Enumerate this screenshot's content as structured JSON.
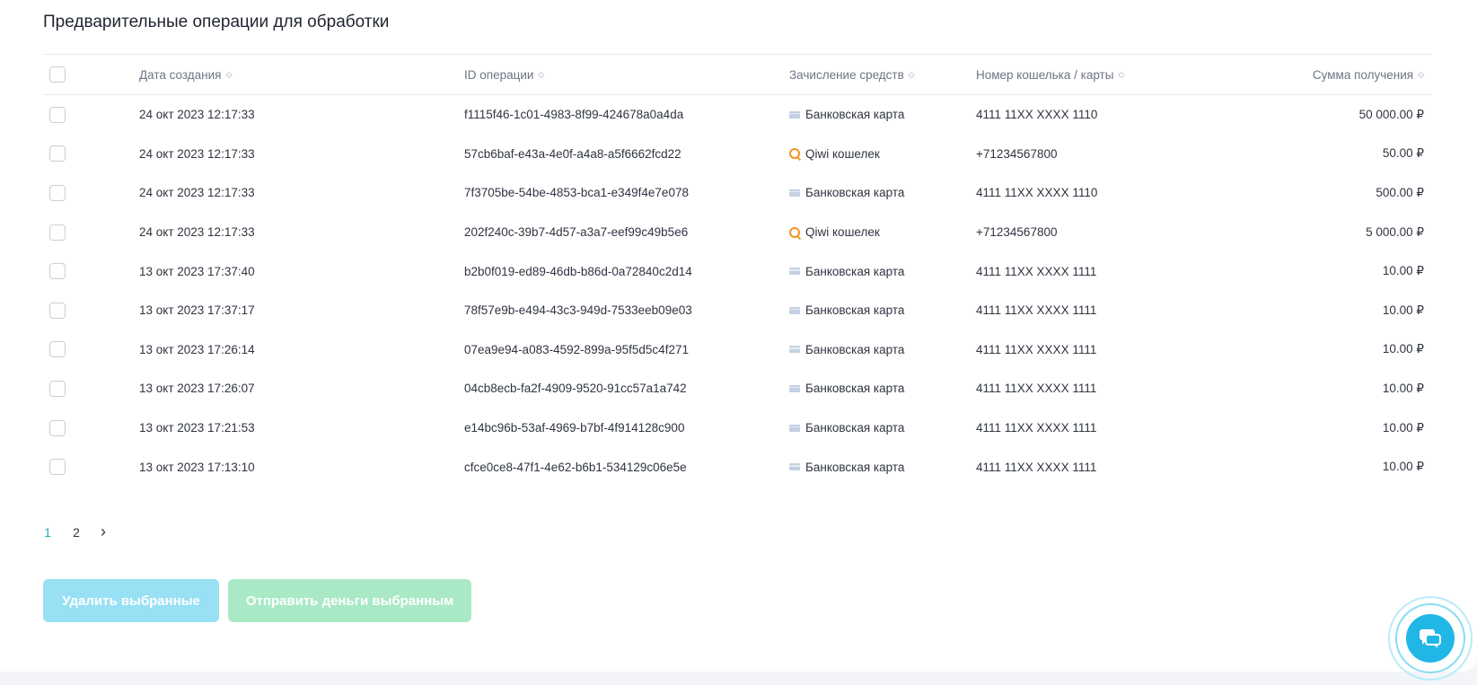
{
  "page": {
    "title": "Предварительные операции для обработки"
  },
  "table": {
    "columns": {
      "date": "Дата создания",
      "id": "ID операции",
      "method": "Зачисление средств",
      "wallet": "Номер кошелька / карты",
      "amount": "Сумма получения"
    },
    "rows": [
      {
        "date": "24 окт 2023 12:17:33",
        "id": "f1115f46-1c01-4983-8f99-424678a0a4da",
        "method_icon": "bank-card-icon",
        "method": "Банковская карта",
        "wallet": "4111 11XX XXXX 1110",
        "amount": "50 000.00 ₽"
      },
      {
        "date": "24 окт 2023 12:17:33",
        "id": "57cb6baf-e43a-4e0f-a4a8-a5f6662fcd22",
        "method_icon": "qiwi-icon",
        "method": "Qiwi кошелек",
        "wallet": "+71234567800",
        "amount": "50.00 ₽"
      },
      {
        "date": "24 окт 2023 12:17:33",
        "id": "7f3705be-54be-4853-bca1-e349f4e7e078",
        "method_icon": "bank-card-icon",
        "method": "Банковская карта",
        "wallet": "4111 11XX XXXX 1110",
        "amount": "500.00 ₽"
      },
      {
        "date": "24 окт 2023 12:17:33",
        "id": "202f240c-39b7-4d57-a3a7-eef99c49b5e6",
        "method_icon": "qiwi-icon",
        "method": "Qiwi кошелек",
        "wallet": "+71234567800",
        "amount": "5 000.00 ₽"
      },
      {
        "date": "13 окт 2023 17:37:40",
        "id": "b2b0f019-ed89-46db-b86d-0a72840c2d14",
        "method_icon": "bank-card-icon",
        "method": "Банковская карта",
        "wallet": "4111 11XX XXXX 1111",
        "amount": "10.00 ₽"
      },
      {
        "date": "13 окт 2023 17:37:17",
        "id": "78f57e9b-e494-43c3-949d-7533eeb09e03",
        "method_icon": "bank-card-icon",
        "method": "Банковская карта",
        "wallet": "4111 11XX XXXX 1111",
        "amount": "10.00 ₽"
      },
      {
        "date": "13 окт 2023 17:26:14",
        "id": "07ea9e94-a083-4592-899a-95f5d5c4f271",
        "method_icon": "bank-card-icon",
        "method": "Банковская карта",
        "wallet": "4111 11XX XXXX 1111",
        "amount": "10.00 ₽"
      },
      {
        "date": "13 окт 2023 17:26:07",
        "id": "04cb8ecb-fa2f-4909-9520-91cc57a1a742",
        "method_icon": "bank-card-icon",
        "method": "Банковская карта",
        "wallet": "4111 11XX XXXX 1111",
        "amount": "10.00 ₽"
      },
      {
        "date": "13 окт 2023 17:21:53",
        "id": "e14bc96b-53af-4969-b7bf-4f914128c900",
        "method_icon": "bank-card-icon",
        "method": "Банковская карта",
        "wallet": "4111 11XX XXXX 1111",
        "amount": "10.00 ₽"
      },
      {
        "date": "13 окт 2023 17:13:10",
        "id": "cfce0ce8-47f1-4e62-b6b1-534129c06e5e",
        "method_icon": "bank-card-icon",
        "method": "Банковская карта",
        "wallet": "4111 11XX XXXX 1111",
        "amount": "10.00 ₽"
      }
    ]
  },
  "pagination": {
    "pages": [
      "1",
      "2"
    ],
    "current": "1"
  },
  "actions": {
    "delete_label": "Удалить выбранные",
    "send_label": "Отправить деньги выбранным"
  },
  "colors": {
    "accent": "#25a6c9",
    "delete_button": "#98e0f4",
    "send_button": "#a9e9c6",
    "chat_button": "#20b7e6",
    "qiwi": "#f39323"
  }
}
